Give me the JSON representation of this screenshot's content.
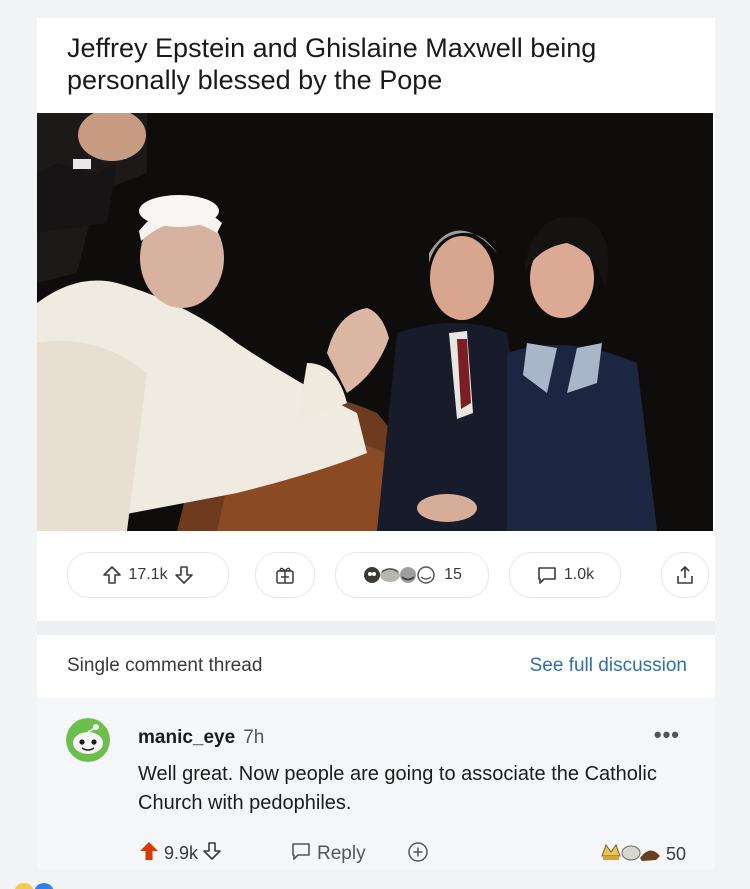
{
  "post": {
    "title": "Jeffrey Epstein and Ghislaine Maxwell being personally blessed by the Pope"
  },
  "actions": {
    "votes": "17.1k",
    "awards_count": "15",
    "comments": "1.0k"
  },
  "thread": {
    "left_label": "Single comment thread",
    "right_link": "See full discussion"
  },
  "comment": {
    "username": "manic_eye",
    "age": "7h",
    "more": "•••",
    "body": "Well great. Now people are going to associate the Catholic Church with pedophiles.",
    "votes": "9.9k",
    "reply_label": "Reply",
    "awards_count": "50"
  },
  "colors": {
    "link": "#2f6fb0",
    "upvote": "#d93a00",
    "card_bg": "#ffffff",
    "comment_bg": "#f4f6f9"
  },
  "icons": {
    "upvote": "arrow-up-icon",
    "downvote": "arrow-down-icon",
    "award": "gift-box-icon",
    "comment": "speech-bubble-icon",
    "share": "share-icon",
    "more": "ellipsis-icon"
  }
}
